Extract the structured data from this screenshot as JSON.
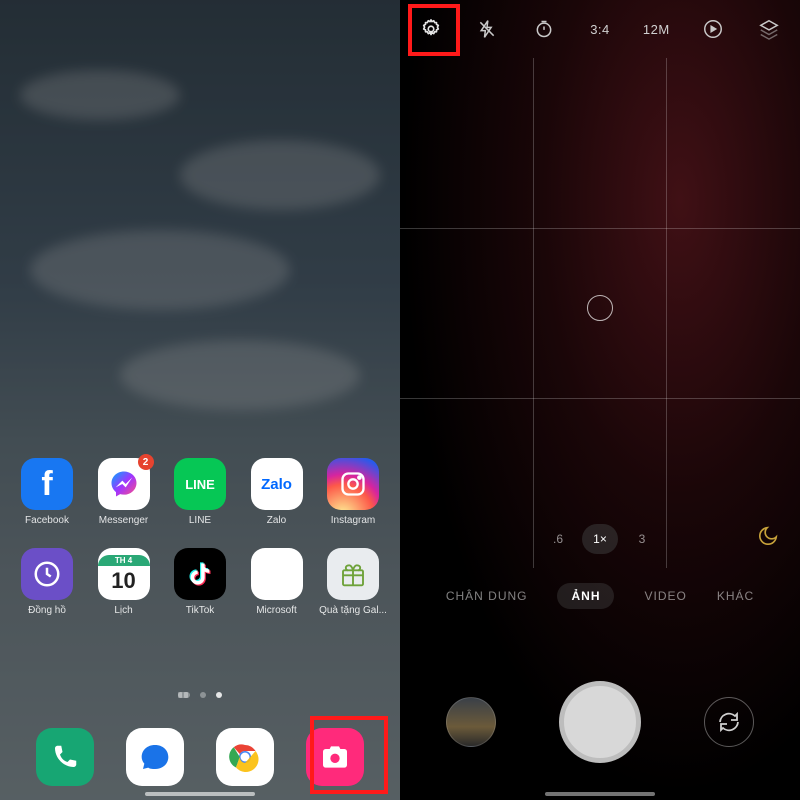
{
  "home": {
    "apps_row1": [
      {
        "name": "facebook",
        "label": "Facebook"
      },
      {
        "name": "messenger",
        "label": "Messenger",
        "badge": "2"
      },
      {
        "name": "line",
        "label": "LINE",
        "text": "LINE"
      },
      {
        "name": "zalo",
        "label": "Zalo",
        "text": "Zalo"
      },
      {
        "name": "instagram",
        "label": "Instagram"
      }
    ],
    "apps_row2": [
      {
        "name": "clock",
        "label": "Đồng hồ"
      },
      {
        "name": "calendar",
        "label": "Lịch",
        "month": "TH 4",
        "day": "10"
      },
      {
        "name": "tiktok",
        "label": "TikTok"
      },
      {
        "name": "microsoft",
        "label": "Microsoft"
      },
      {
        "name": "galaxy-gift",
        "label": "Quà tặng Gal..."
      }
    ],
    "dock": [
      {
        "name": "phone"
      },
      {
        "name": "messages"
      },
      {
        "name": "chrome"
      },
      {
        "name": "camera"
      }
    ]
  },
  "camera": {
    "topbar": {
      "aspect_ratio": "3:4",
      "resolution": "12M"
    },
    "zooms": [
      ".6",
      "1×",
      "3"
    ],
    "zoom_active_index": 1,
    "modes": [
      "CHÂN DUNG",
      "ẢNH",
      "VIDEO",
      "KHÁC"
    ],
    "mode_active_index": 1
  }
}
